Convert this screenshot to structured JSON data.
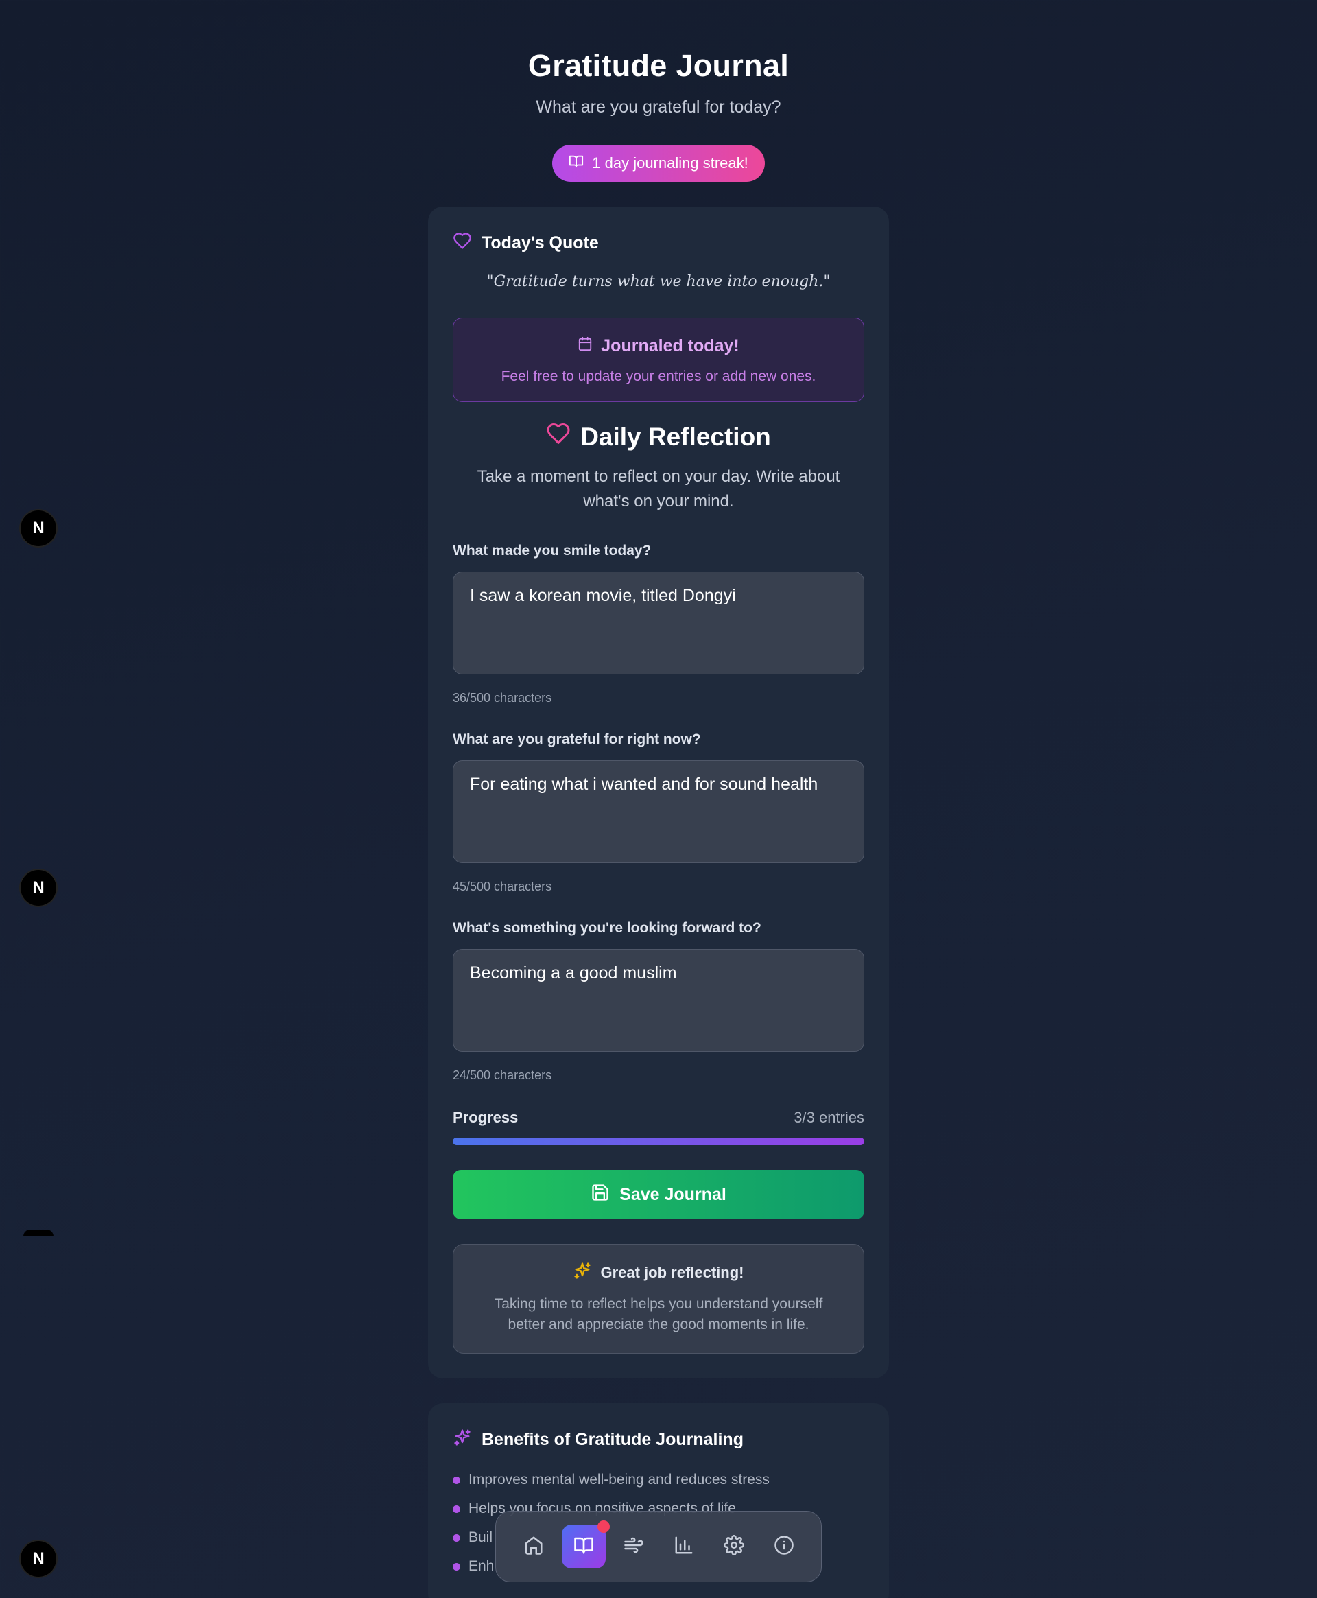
{
  "header": {
    "title": "Gratitude Journal",
    "subtitle": "What are you grateful for today?",
    "streak_label": "1 day journaling streak!"
  },
  "quote": {
    "heading": "Today's Quote",
    "text": "\"Gratitude turns what we have into enough.\""
  },
  "status": {
    "title": "Journaled today!",
    "message": "Feel free to update your entries or add new ones."
  },
  "reflection": {
    "title": "Daily Reflection",
    "subtitle": "Take a moment to reflect on your day. Write about what's on your mind."
  },
  "entries": [
    {
      "label": "What made you smile today?",
      "value": "I saw a korean movie, titled Dongyi",
      "count": "36/500 characters"
    },
    {
      "label": "What are you grateful for right now?",
      "value": "For eating what i wanted and for sound health",
      "count": "45/500 characters"
    },
    {
      "label": "What's something you're looking forward to?",
      "value": "Becoming a a good muslim",
      "count": "24/500 characters"
    }
  ],
  "progress": {
    "label": "Progress",
    "value_text": "3/3 entries",
    "fraction": 1.0
  },
  "save_label": "Save Journal",
  "encouragement": {
    "title": "Great job reflecting!",
    "message": "Taking time to reflect helps you understand yourself better and appreciate the good moments in life."
  },
  "benefits": {
    "title": "Benefits of Gratitude Journaling",
    "items": [
      "Improves mental well-being and reduces stress",
      "Helps you focus on positive aspects of life",
      "Buil",
      "Enh"
    ]
  },
  "nav": {
    "items": [
      "home-icon",
      "book-icon",
      "wind-icon",
      "chart-icon",
      "settings-icon",
      "info-icon"
    ],
    "active": "book-icon"
  },
  "dev_badge_letter": "N",
  "colors": {
    "background": "#182135",
    "card": "#1f2a3c",
    "accent_purple": "#b44be8",
    "accent_pink": "#ec4899",
    "save_green": "#22c55e"
  }
}
